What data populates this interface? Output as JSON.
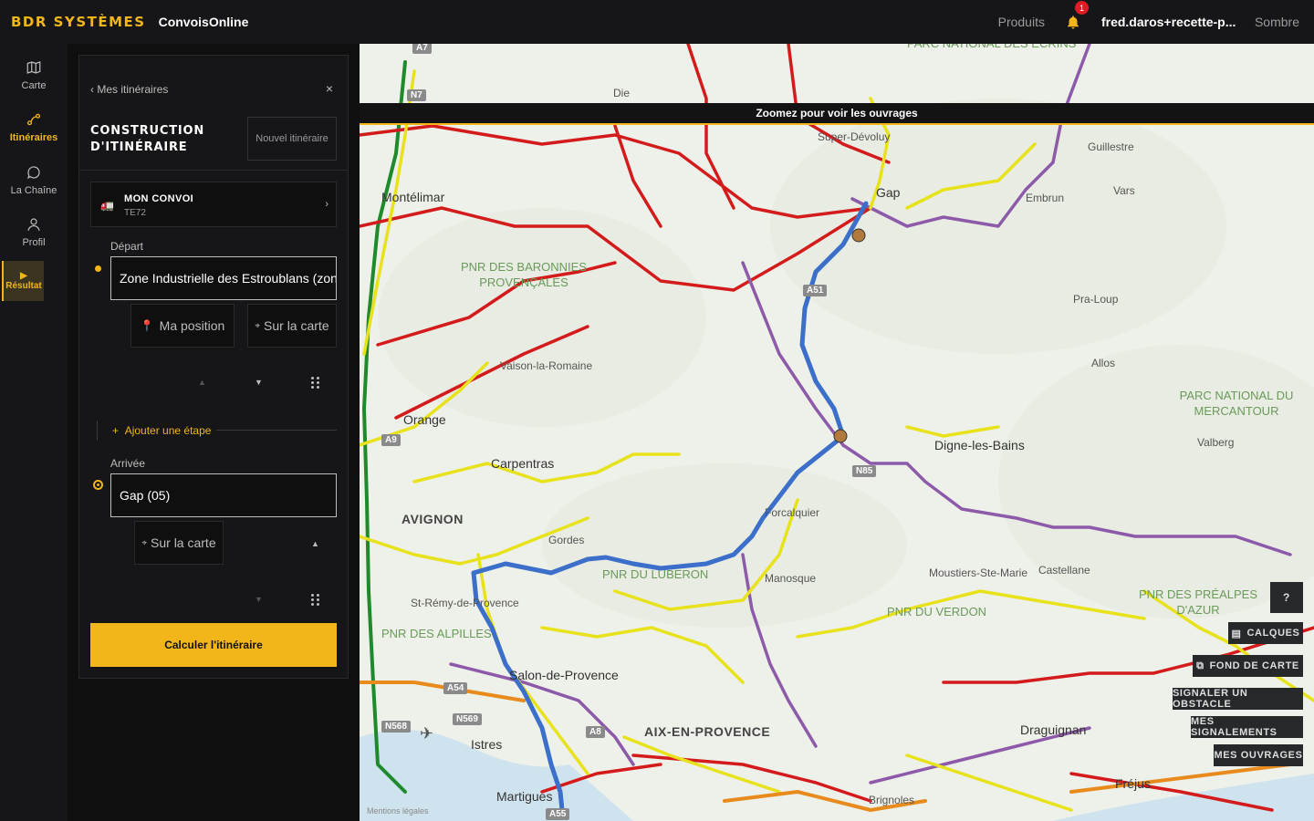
{
  "header": {
    "brand": "BDR SYSTÈMES",
    "app_name": "ConvoisOnline",
    "products_label": "Produits",
    "notification_count": "1",
    "user": "fred.daros+recette-p...",
    "theme_label": "Sombre"
  },
  "rail": {
    "items": [
      {
        "label": "Carte",
        "icon": "map-icon"
      },
      {
        "label": "Itinéraires",
        "icon": "route-icon"
      },
      {
        "label": "La Chaîne",
        "icon": "chat-icon"
      },
      {
        "label": "Profil",
        "icon": "person-icon"
      }
    ],
    "result_label": "Résultat"
  },
  "panel": {
    "back_label": "Mes itinéraires",
    "close_label": "×",
    "title": "CONSTRUCTION D'ITINÉRAIRE",
    "new_button": "Nouvel itinéraire",
    "convoi": {
      "title": "MON CONVOI",
      "subtitle": "TE72",
      "chevron": "›"
    },
    "departure": {
      "label": "Départ",
      "value": "Zone Industrielle des Estroublans (zone",
      "my_position": "Ma position",
      "on_map": "Sur la carte"
    },
    "add_step": "Ajouter une étape",
    "arrival": {
      "label": "Arrivée",
      "value": "Gap (05)",
      "on_map": "Sur la carte"
    },
    "calculate": "Calculer l'itinéraire"
  },
  "map": {
    "banner": "Zoomez pour voir les ouvrages",
    "legal": "Mentions légales",
    "places": [
      {
        "name": "Die"
      },
      {
        "name": "PARC NATIONAL DES ÉCRINS"
      },
      {
        "name": "Super-Dévoluy"
      },
      {
        "name": "Guillestre"
      },
      {
        "name": "Gap"
      },
      {
        "name": "Embrun"
      },
      {
        "name": "Vars"
      },
      {
        "name": "Montélimar"
      },
      {
        "name": "PNR DES BARONNIES PROVENÇALES"
      },
      {
        "name": "Pra-Loup"
      },
      {
        "name": "Allos"
      },
      {
        "name": "Vaison-la-Romaine"
      },
      {
        "name": "Orange"
      },
      {
        "name": "PARC NATIONAL DU MERCANTOUR"
      },
      {
        "name": "Digne-les-Bains"
      },
      {
        "name": "Valberg"
      },
      {
        "name": "Carpentras"
      },
      {
        "name": "AVIGNON"
      },
      {
        "name": "Forcalquier"
      },
      {
        "name": "Gordes"
      },
      {
        "name": "PNR DU LUBERON"
      },
      {
        "name": "Manosque"
      },
      {
        "name": "Moustiers-Ste-Marie"
      },
      {
        "name": "Castellane"
      },
      {
        "name": "St-Rémy-de-Provence"
      },
      {
        "name": "PNR DU VERDON"
      },
      {
        "name": "PNR DES PRÉALPES D'AZUR"
      },
      {
        "name": "PNR DES ALPILLES"
      },
      {
        "name": "Salon-de-Provence"
      },
      {
        "name": "AIX-EN-PROVENCE"
      },
      {
        "name": "Istres"
      },
      {
        "name": "Draguignan"
      },
      {
        "name": "Martigues"
      },
      {
        "name": "Fréjus"
      },
      {
        "name": "Brignoles"
      }
    ],
    "roads": [
      "A7",
      "N7",
      "A51",
      "A9",
      "A54",
      "N568",
      "N569",
      "A8",
      "A55",
      "N85"
    ],
    "buttons": {
      "help": "?",
      "layers": "CALQUES",
      "basemap": "FOND DE CARTE",
      "report": "SIGNALER UN OBSTACLE",
      "my_reports": "MES SIGNALEMENTS",
      "my_structures": "MES OUVRAGES"
    }
  },
  "colors": {
    "accent": "#f2b51a",
    "route": "#3b6fc9",
    "road_red": "#d41b1b",
    "road_yellow": "#e8e21c",
    "road_purple": "#8c5aa8",
    "road_green": "#1f8a2c",
    "road_orange": "#e88a1c"
  }
}
